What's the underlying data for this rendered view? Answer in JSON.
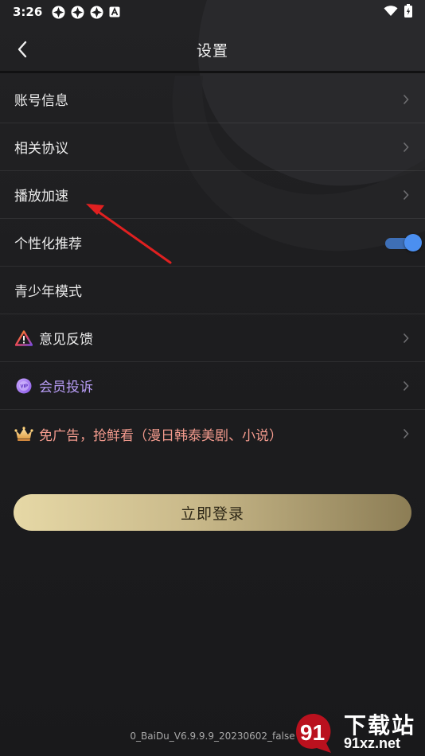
{
  "status_bar": {
    "time": "3:26",
    "icons_left": [
      "notification-icon",
      "notification-icon",
      "notification-icon",
      "a-badge-icon"
    ],
    "icons_right": [
      "wifi-icon",
      "battery-icon"
    ]
  },
  "header": {
    "back_icon": "chevron-left-icon",
    "title": "设置"
  },
  "settings": {
    "items": [
      {
        "label": "账号信息",
        "trailing": "chevron"
      },
      {
        "label": "相关协议",
        "trailing": "chevron"
      },
      {
        "label": "播放加速",
        "trailing": "chevron"
      },
      {
        "label": "个性化推荐",
        "trailing": "toggle",
        "toggle_on": true
      },
      {
        "label": "青少年模式",
        "trailing": "none"
      },
      {
        "label": "意见反馈",
        "icon": "warning-triangle-icon",
        "trailing": "chevron"
      },
      {
        "label": "会员投诉",
        "icon": "vip-badge-icon",
        "trailing": "chevron"
      },
      {
        "label": "免广告，抢鲜看（漫日韩泰美剧、小说）",
        "icon": "crown-icon",
        "trailing": "chevron"
      }
    ]
  },
  "login_button": {
    "label": "立即登录"
  },
  "version": "0_BaiDu_V6.9.9.9_20230602_false",
  "watermark": {
    "logo": "91",
    "title": "下载站",
    "site": "91xz.net"
  },
  "colors": {
    "background": "#1b1b1d",
    "toggle_accent": "#4b8ff0",
    "vip_text": "#b79cf5",
    "promo_text": "#f29a8d",
    "login_gold": "#d8c898",
    "annotation_arrow": "#e02020"
  }
}
